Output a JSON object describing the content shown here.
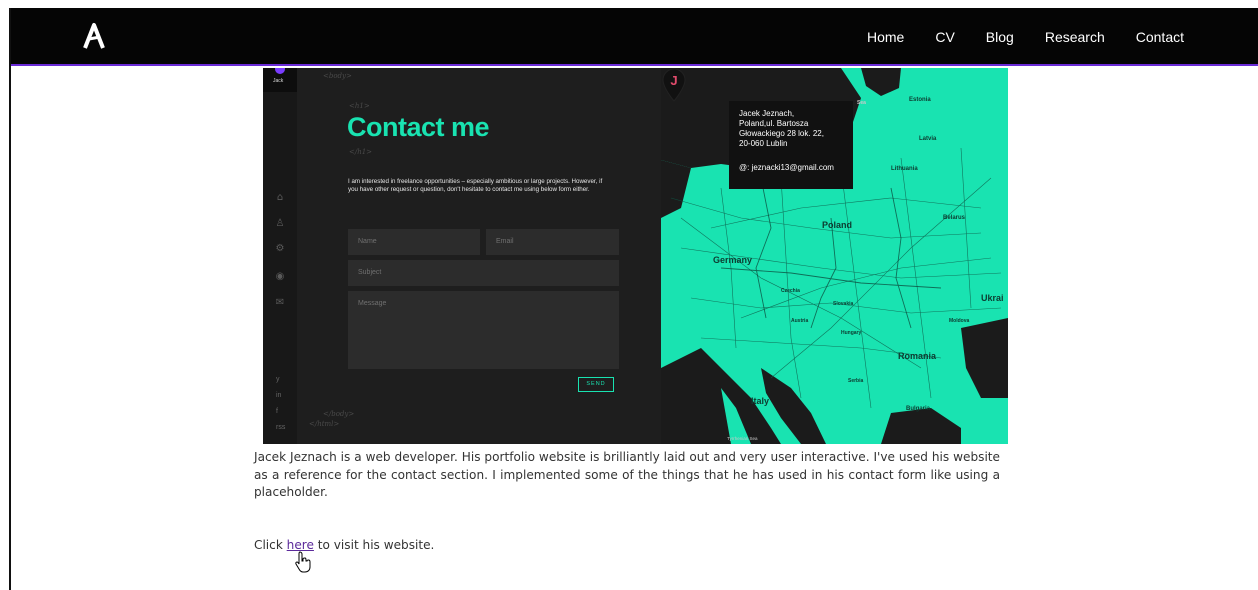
{
  "nav": {
    "links": [
      "Home",
      "CV",
      "Blog",
      "Research",
      "Contact"
    ]
  },
  "shot": {
    "avatar_name": "Jack",
    "tags": {
      "body_open": "<body>",
      "h1_open": "<h1>",
      "h1_close": "</h1>",
      "body_close": "</body>",
      "html_close": "</html>"
    },
    "title": "Contact me",
    "intro": "I am interested in freelance opportunities – especially ambitious or large projects. However, if you have other request or question, don't hesitate to contact me using below form either.",
    "form": {
      "name_placeholder": "Name",
      "email_placeholder": "Email",
      "subject_placeholder": "Subject",
      "message_placeholder": "Message",
      "send_label": "SEND"
    },
    "social": [
      "y",
      "in",
      "f",
      "rss"
    ],
    "map": {
      "popup_lines": [
        "Jacek Jeznach,",
        "Poland,ul. Bartosza",
        "Głowackiego 28 lok. 22,",
        "20-060 Lublin"
      ],
      "popup_email": "@: jeznacki13@gmail.com",
      "countries": [
        "Estonia",
        "Latvia",
        "Lithuania",
        "Belarus",
        "Poland",
        "Germany",
        "Ukrai",
        "Czechia",
        "Slovakia",
        "Austria",
        "Hungary",
        "Moldova",
        "Romania",
        "Italy",
        "Bulgaria",
        "Serbia",
        "Sea",
        "Tyrrhenian Sea"
      ],
      "pin_letter": "J"
    }
  },
  "description": "Jacek Jeznach is a web developer. His portfolio website is brilliantly laid out and very user interactive. I've used his website as a reference for the contact section. I implemented some of the things that he has used in his contact form like using a placeholder.",
  "visit": {
    "prefix": "Click ",
    "link": "here",
    "suffix": " to visit his website."
  },
  "colors": {
    "accent": "#19e3b1",
    "nav_border": "#6a2bd6",
    "link": "#5b2a9a"
  }
}
